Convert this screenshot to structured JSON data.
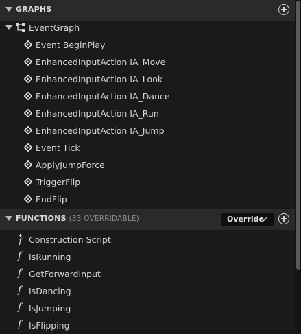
{
  "graphs": {
    "title": "GRAPHS",
    "event_graph": "EventGraph",
    "events": [
      "Event BeginPlay",
      "EnhancedInputAction IA_Move",
      "EnhancedInputAction IA_Look",
      "EnhancedInputAction IA_Dance",
      "EnhancedInputAction IA_Run",
      "EnhancedInputAction IA_Jump",
      "Event Tick",
      "ApplyJumpForce",
      "TriggerFlip",
      "EndFlip"
    ]
  },
  "functions": {
    "title": "FUNCTIONS",
    "subtitle": "(33 OVERRIDABLE)",
    "override_label": "Override",
    "items": [
      "Construction Script",
      "IsRunning",
      "GetForwardInput",
      "IsDancing",
      "IsJumping",
      "IsFlipping"
    ]
  },
  "icons": {
    "collapse": "triangle-down-icon",
    "add": "plus-circle-icon",
    "event": "event-node-icon",
    "graph": "graph-icon",
    "function": "function-icon"
  }
}
